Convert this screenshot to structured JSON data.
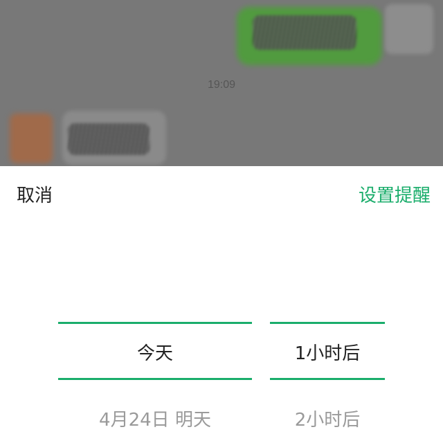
{
  "chat": {
    "timestamp": "19:09"
  },
  "sheet": {
    "cancel_label": "取消",
    "confirm_label": "设置提醒"
  },
  "picker": {
    "dates": {
      "selected": "今天",
      "next": "4月24日 明天"
    },
    "hours": {
      "selected": "1小时后",
      "next": "2小时后"
    }
  },
  "colors": {
    "accent": "#1aad6b",
    "overlay": "#787878",
    "text_primary": "#222222",
    "text_muted": "#9a9a9a"
  }
}
